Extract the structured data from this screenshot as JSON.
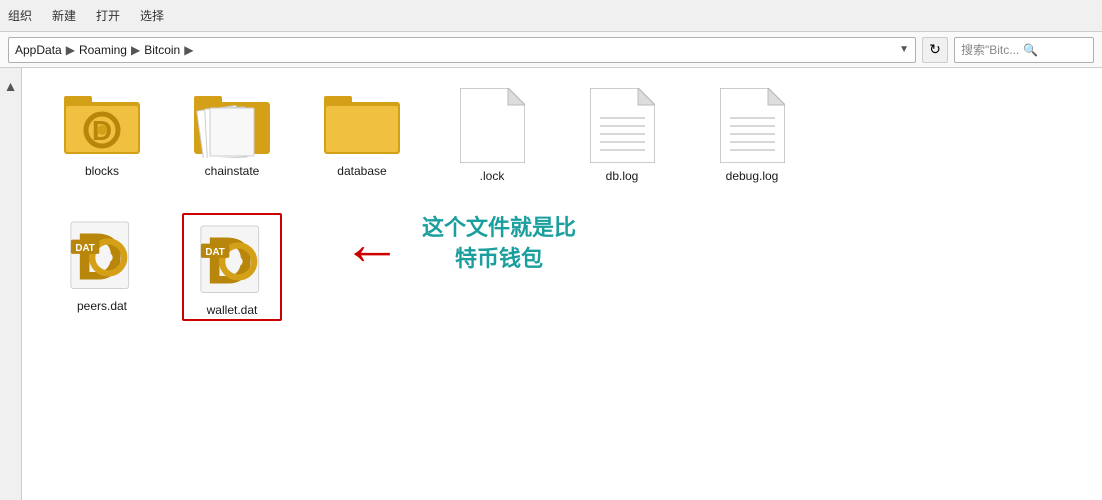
{
  "toolbar": {
    "items": [
      "组织",
      "新建",
      "打开",
      "选择"
    ]
  },
  "addressbar": {
    "parts": [
      "AppData",
      "Roaming",
      "Bitcoin"
    ],
    "search_placeholder": "搜索\"Bitc...",
    "refresh_tooltip": "刷新"
  },
  "files": {
    "row1": [
      {
        "id": "blocks",
        "label": "blocks",
        "type": "folder-gold"
      },
      {
        "id": "chainstate",
        "label": "chainstate",
        "type": "folder-plain"
      },
      {
        "id": "database",
        "label": "database",
        "type": "folder-plain"
      },
      {
        "id": "lock",
        "label": ".lock",
        "type": "text-file"
      },
      {
        "id": "dblog",
        "label": "db.log",
        "type": "text-lined"
      },
      {
        "id": "debuglog",
        "label": "debug.log",
        "type": "text-lined"
      }
    ],
    "row2": [
      {
        "id": "peers",
        "label": "peers.dat",
        "type": "dat",
        "highlighted": false
      },
      {
        "id": "wallet",
        "label": "wallet.dat",
        "type": "dat",
        "highlighted": true
      }
    ]
  },
  "annotation": {
    "arrow": "←",
    "text_line1": "这个文件就是比",
    "text_line2": "特币钱包"
  }
}
